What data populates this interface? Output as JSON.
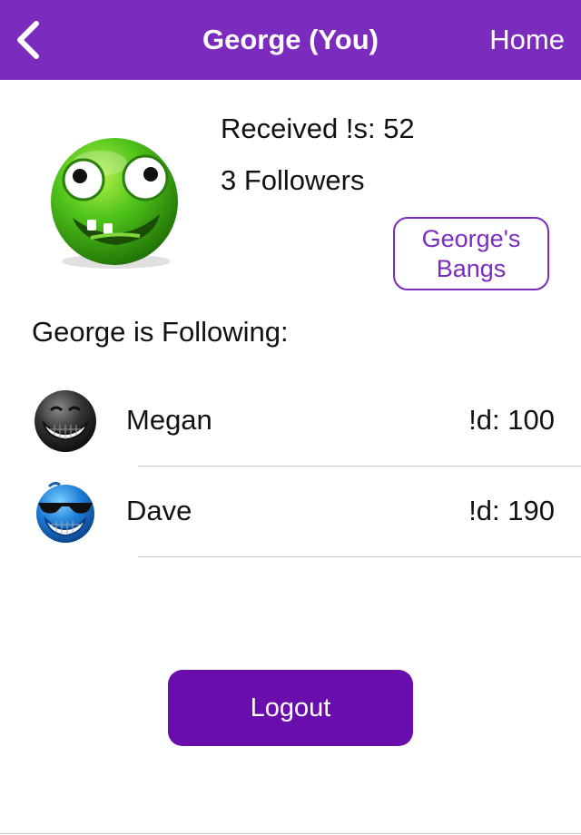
{
  "nav": {
    "title": "George (You)",
    "home_label": "Home",
    "color": "#7b2cbf"
  },
  "profile": {
    "avatar_icon": "green-smiley-avatar",
    "received": "Received !s: 52",
    "followers": "3 Followers",
    "bangs_label": "George's Bangs"
  },
  "following": {
    "heading": "George is Following:",
    "items": [
      {
        "name": "Megan",
        "score": "!d: 100",
        "avatar_icon": "black-grinning-smiley"
      },
      {
        "name": "Dave",
        "score": "!d: 190",
        "avatar_icon": "blue-sunglasses-smiley"
      }
    ]
  },
  "logout_label": "Logout",
  "accent": "#6a0dad"
}
